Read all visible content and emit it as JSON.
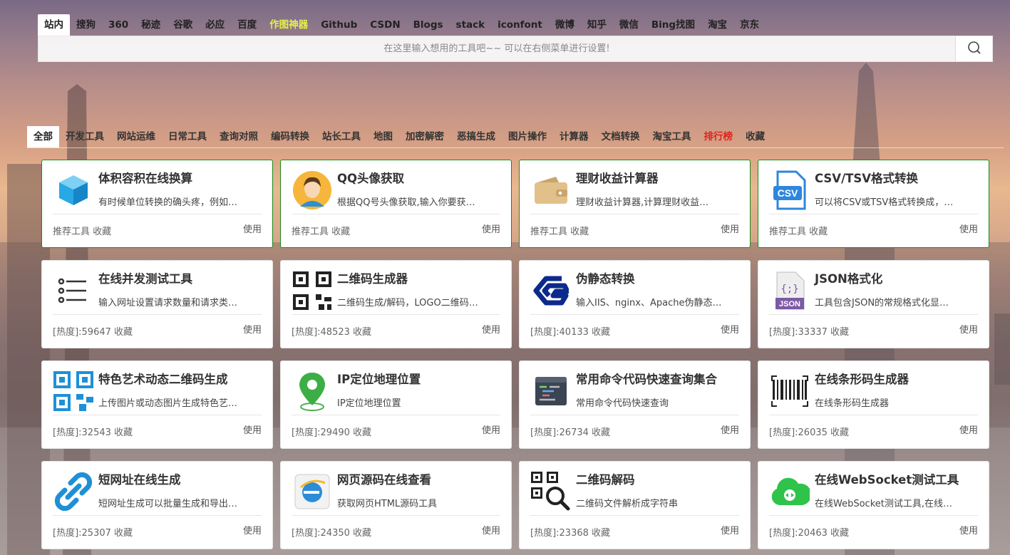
{
  "engine_tabs": [
    {
      "label": "站内",
      "active": true
    },
    {
      "label": "搜狗"
    },
    {
      "label": "360"
    },
    {
      "label": "秘迹"
    },
    {
      "label": "谷歌"
    },
    {
      "label": "必应"
    },
    {
      "label": "百度"
    },
    {
      "label": "作图神器",
      "highlight": true
    },
    {
      "label": "Github"
    },
    {
      "label": "CSDN"
    },
    {
      "label": "Blogs"
    },
    {
      "label": "stack"
    },
    {
      "label": "iconfont"
    },
    {
      "label": "微博"
    },
    {
      "label": "知乎"
    },
    {
      "label": "微信"
    },
    {
      "label": "Bing找图"
    },
    {
      "label": "淘宝"
    },
    {
      "label": "京东"
    }
  ],
  "search": {
    "placeholder": "在这里输入想用的工具吧~~ 可以在右侧菜单进行设置!",
    "button_icon": "search-icon"
  },
  "category_tabs": [
    {
      "label": "全部",
      "active": true
    },
    {
      "label": "开发工具"
    },
    {
      "label": "网站运维"
    },
    {
      "label": "日常工具"
    },
    {
      "label": "查询对照"
    },
    {
      "label": "编码转换"
    },
    {
      "label": "站长工具"
    },
    {
      "label": "地图"
    },
    {
      "label": "加密解密"
    },
    {
      "label": "恶搞生成"
    },
    {
      "label": "图片操作"
    },
    {
      "label": "计算器"
    },
    {
      "label": "文档转换"
    },
    {
      "label": "淘宝工具"
    },
    {
      "label": "排行榜",
      "red": true
    },
    {
      "label": "收藏"
    }
  ],
  "cards": [
    {
      "title": "体积容积在线换算",
      "desc": "有时候单位转换的确头疼，例如…",
      "meta": "推荐工具 收藏",
      "use": "使用",
      "icon": "cube-icon",
      "featured": true
    },
    {
      "title": "QQ头像获取",
      "desc": "根据QQ号头像获取,输入你要获…",
      "meta": "推荐工具 收藏",
      "use": "使用",
      "icon": "avatar-icon",
      "featured": true
    },
    {
      "title": "理财收益计算器",
      "desc": "理财收益计算器,计算理财收益…",
      "meta": "推荐工具 收藏",
      "use": "使用",
      "icon": "wallet-icon",
      "featured": true
    },
    {
      "title": "CSV/TSV格式转换",
      "desc": "可以将CSV或TSV格式转换成，…",
      "meta": "推荐工具 收藏",
      "use": "使用",
      "icon": "csv-file-icon",
      "featured": true
    },
    {
      "title": "在线并发测试工具",
      "desc": "输入网址设置请求数量和请求类…",
      "meta": "[热度]:59647 收藏",
      "use": "使用",
      "icon": "list-icon"
    },
    {
      "title": "二维码生成器",
      "desc": "二维码生成/解码，LOGO二维码…",
      "meta": "[热度]:48523 收藏",
      "use": "使用",
      "icon": "qrcode-icon"
    },
    {
      "title": "伪静态转换",
      "desc": "输入IIS、nginx、Apache伪静态…",
      "meta": "[热度]:40133 收藏",
      "use": "使用",
      "icon": "g-logo-icon"
    },
    {
      "title": "JSON格式化",
      "desc": "工具包含JSON的常规格式化显…",
      "meta": "[热度]:33337 收藏",
      "use": "使用",
      "icon": "json-file-icon"
    },
    {
      "title": "特色艺术动态二维码生成",
      "desc": "上传图片或动态图片生成特色艺…",
      "meta": "[热度]:32543 收藏",
      "use": "使用",
      "icon": "blue-qrcode-icon"
    },
    {
      "title": "IP定位地理位置",
      "desc": "IP定位地理位置",
      "meta": "[热度]:29490 收藏",
      "use": "使用",
      "icon": "map-pin-icon"
    },
    {
      "title": "常用命令代码快速查询集合",
      "desc": "常用命令代码快速查询",
      "meta": "[热度]:26734 收藏",
      "use": "使用",
      "icon": "code-editor-icon"
    },
    {
      "title": "在线条形码生成器",
      "desc": "在线条形码生成器",
      "meta": "[热度]:26035 收藏",
      "use": "使用",
      "icon": "barcode-icon"
    },
    {
      "title": "短网址在线生成",
      "desc": "短网址生成可以批量生成和导出…",
      "meta": "[热度]:25307 收藏",
      "use": "使用",
      "icon": "link-icon"
    },
    {
      "title": "网页源码在线查看",
      "desc": "获取网页HTML源码工具",
      "meta": "[热度]:24350 收藏",
      "use": "使用",
      "icon": "ie-browser-icon"
    },
    {
      "title": "二维码解码",
      "desc": "二维码文件解析成字符串",
      "meta": "[热度]:23368 收藏",
      "use": "使用",
      "icon": "qrcode-search-icon"
    },
    {
      "title": "在线WebSocket测试工具",
      "desc": "在线WebSocket测试工具,在线…",
      "meta": "[热度]:20463 收藏",
      "use": "使用",
      "icon": "cloud-icon"
    }
  ]
}
